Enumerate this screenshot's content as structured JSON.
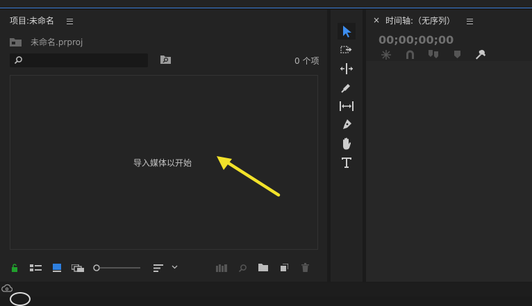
{
  "project_panel": {
    "title": "项目:未命名",
    "file_name": "未命名.prproj",
    "search_placeholder": "",
    "item_count": "0 个项",
    "drop_hint": "导入媒体以开始"
  },
  "timeline_panel": {
    "close": "×",
    "title": "时间轴:（无序列）",
    "timecode": "00;00;00;00"
  },
  "tools": [
    "selection-tool",
    "track-select-forward-tool",
    "ripple-edit-tool",
    "razor-tool",
    "slip-tool",
    "pen-tool",
    "hand-tool",
    "type-tool"
  ],
  "colors": {
    "accent": "#3a7dd8",
    "lock_green": "#21a02d",
    "arrow_yellow": "#f2e22a"
  }
}
